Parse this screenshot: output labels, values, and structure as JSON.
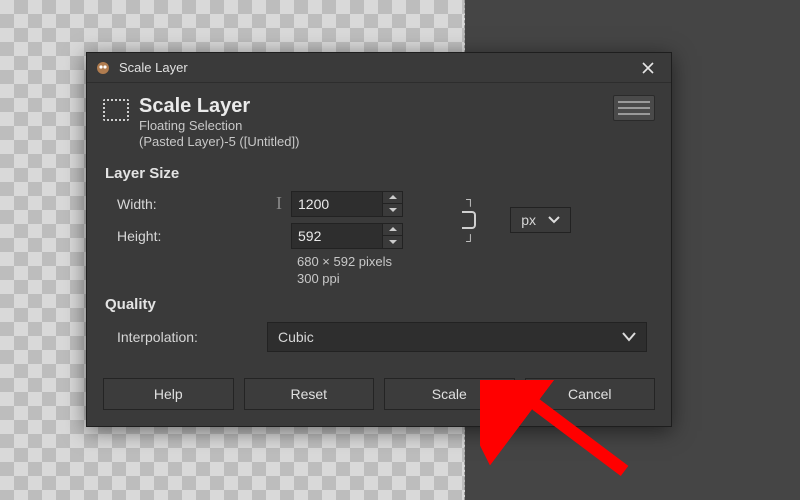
{
  "titlebar": {
    "title": "Scale Layer"
  },
  "header": {
    "title": "Scale Layer",
    "subtitle1": "Floating Selection",
    "subtitle2": "(Pasted Layer)-5 ([Untitled])"
  },
  "layer_size": {
    "section_label": "Layer Size",
    "width_label": "Width:",
    "height_label": "Height:",
    "width_value": "1200",
    "height_value": "592",
    "unit_value": "px",
    "info_dims": "680 × 592 pixels",
    "info_ppi": "300 ppi"
  },
  "quality": {
    "section_label": "Quality",
    "interp_label": "Interpolation:",
    "interp_value": "Cubic"
  },
  "buttons": {
    "help": "Help",
    "reset": "Reset",
    "scale": "Scale",
    "cancel": "Cancel"
  }
}
